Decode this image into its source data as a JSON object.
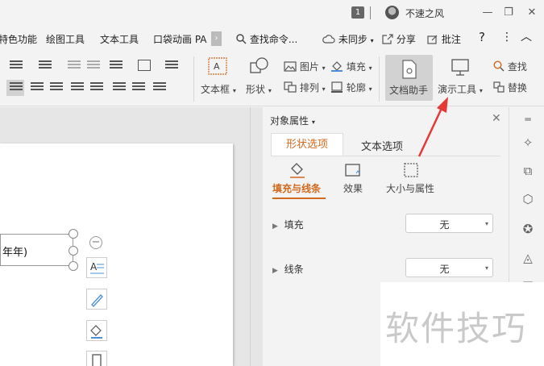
{
  "titlebar": {
    "badge": "1",
    "username": "不速之风",
    "minimize": "—",
    "restore": "❐",
    "close": "✕"
  },
  "menu_tabs": {
    "items": [
      "特色功能",
      "绘图工具",
      "文本工具",
      "口袋动画 PA"
    ],
    "scroll": "›",
    "search": "查找命令...",
    "sync": "未同步",
    "share": "分享",
    "annotate": "批注",
    "help": "?",
    "more": "⋮",
    "collapse": "︿"
  },
  "ribbon": {
    "textbox": "文本框",
    "shape": "形状",
    "picture": "图片",
    "fill": "填充",
    "arrange": "排列",
    "outline": "轮廓",
    "doc_assistant": "文档助手",
    "present_tools": "演示工具",
    "find": "查找",
    "replace": "替换"
  },
  "slide": {
    "textbox_text": "年年)"
  },
  "panel": {
    "title": "对象属性",
    "tabs": [
      "形状选项",
      "文本选项"
    ],
    "subtabs": [
      "填充与线条",
      "效果",
      "大小与属性"
    ],
    "rows": [
      {
        "label": "填充",
        "value": "无"
      },
      {
        "label": "线条",
        "value": "无"
      }
    ]
  },
  "watermark": "软件技巧",
  "colors": {
    "accent": "#d2691e",
    "arrow": "#e53935"
  }
}
